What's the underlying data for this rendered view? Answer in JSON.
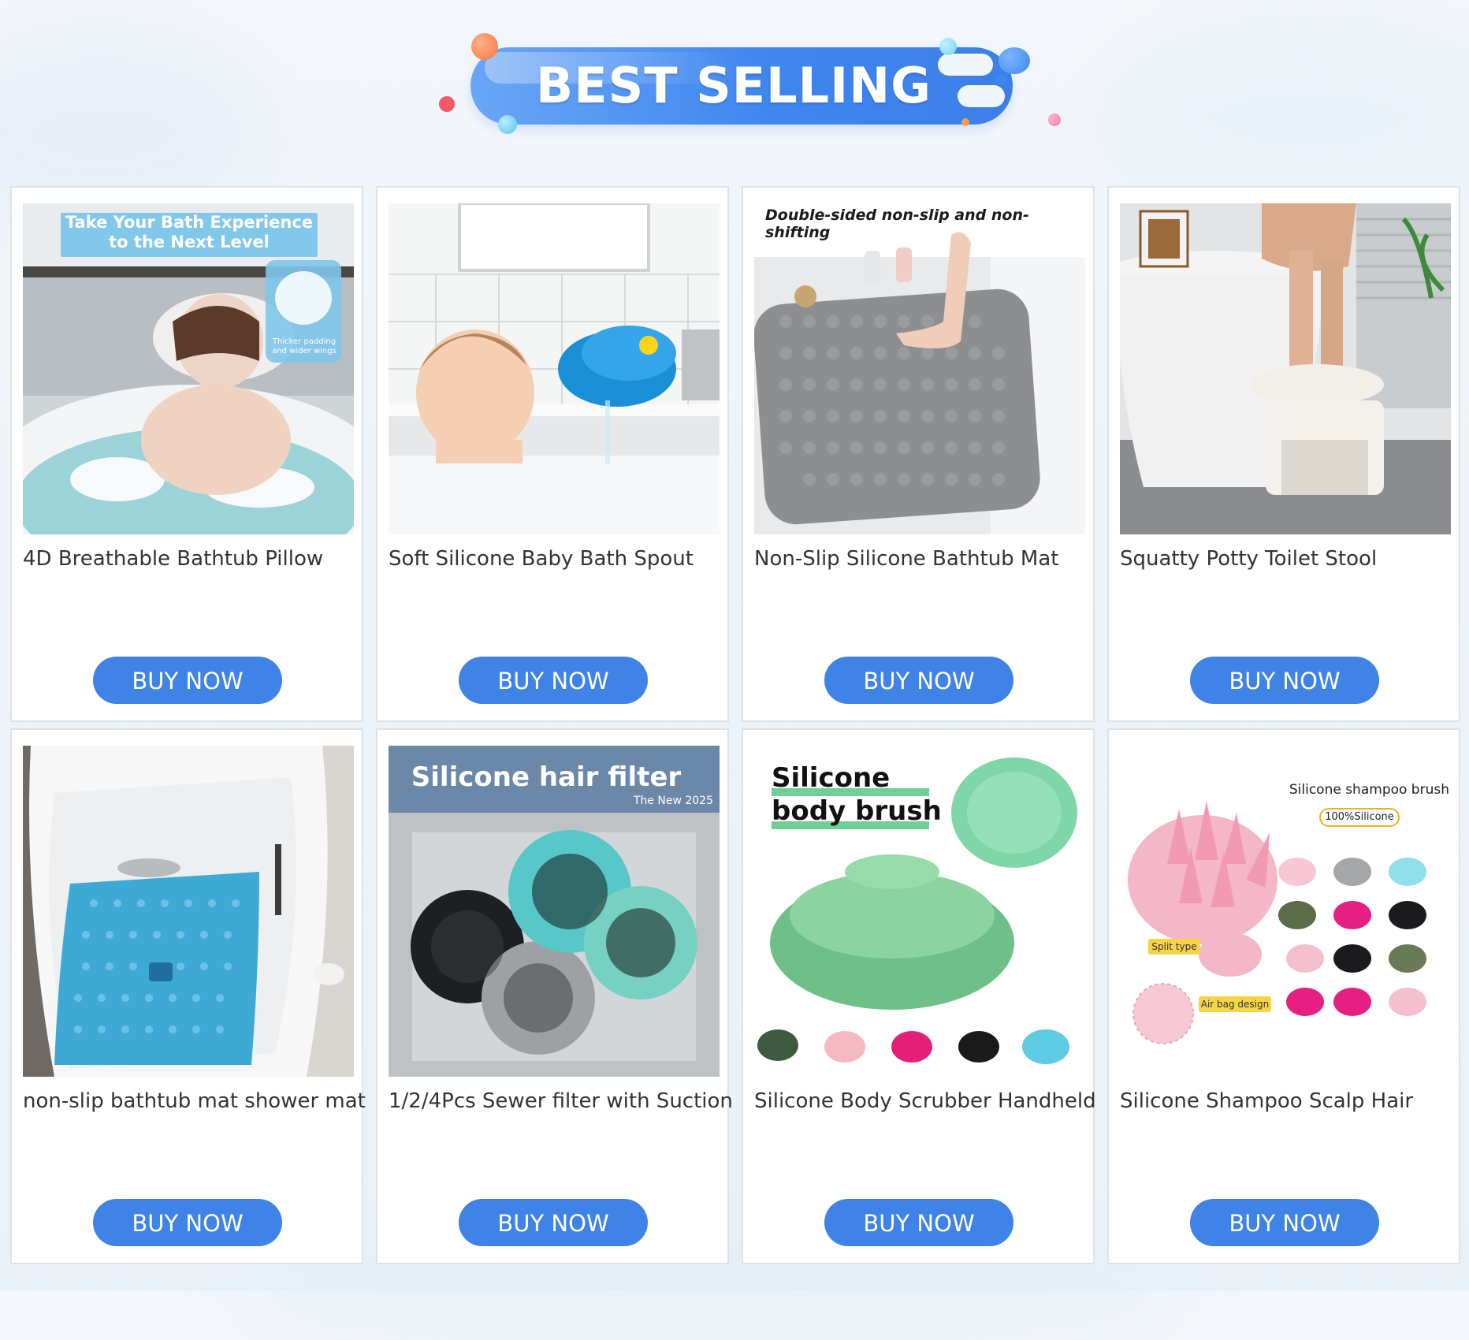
{
  "banner": {
    "title": "BEST SELLING"
  },
  "colors": {
    "accent": "#3f83e6",
    "banner_gradient_start": "#6aa6f6",
    "banner_gradient_end": "#3d7fe9",
    "card_border": "#dde3ea",
    "title_text": "#333333"
  },
  "products": [
    {
      "title": "4D Breathable Bathtub Pillow",
      "button": "BUY NOW",
      "image_caption_line1": "Take Your Bath Experience",
      "image_caption_line2": "to the Next Level",
      "image_badge_line1": "Thicker padding",
      "image_badge_line2": "and wider wings"
    },
    {
      "title": "Soft Silicone Baby Bath Spout",
      "button": "BUY NOW"
    },
    {
      "title": "Non-Slip Silicone Bathtub Mat",
      "button": "BUY NOW",
      "image_caption": "Double-sided non-slip and non-shifting"
    },
    {
      "title": "Squatty Potty Toilet Stool",
      "button": "BUY NOW"
    },
    {
      "title": "non-slip bathtub mat shower mat",
      "button": "BUY NOW"
    },
    {
      "title": "1/2/4Pcs Sewer filter with Suction",
      "button": "BUY NOW",
      "image_caption": "Silicone hair filter",
      "image_subcaption": "The New 2025"
    },
    {
      "title": "Silicone Body Scrubber Handheld",
      "button": "BUY NOW",
      "image_caption_line1": "Silicone",
      "image_caption_line2": "body brush"
    },
    {
      "title": "Silicone Shampoo Scalp Hair",
      "button": "BUY NOW",
      "image_caption": "Silicone shampoo brush",
      "image_badge": "100%Silicone",
      "image_label_split": "Split type",
      "image_label_airbag": "Air bag design"
    }
  ]
}
